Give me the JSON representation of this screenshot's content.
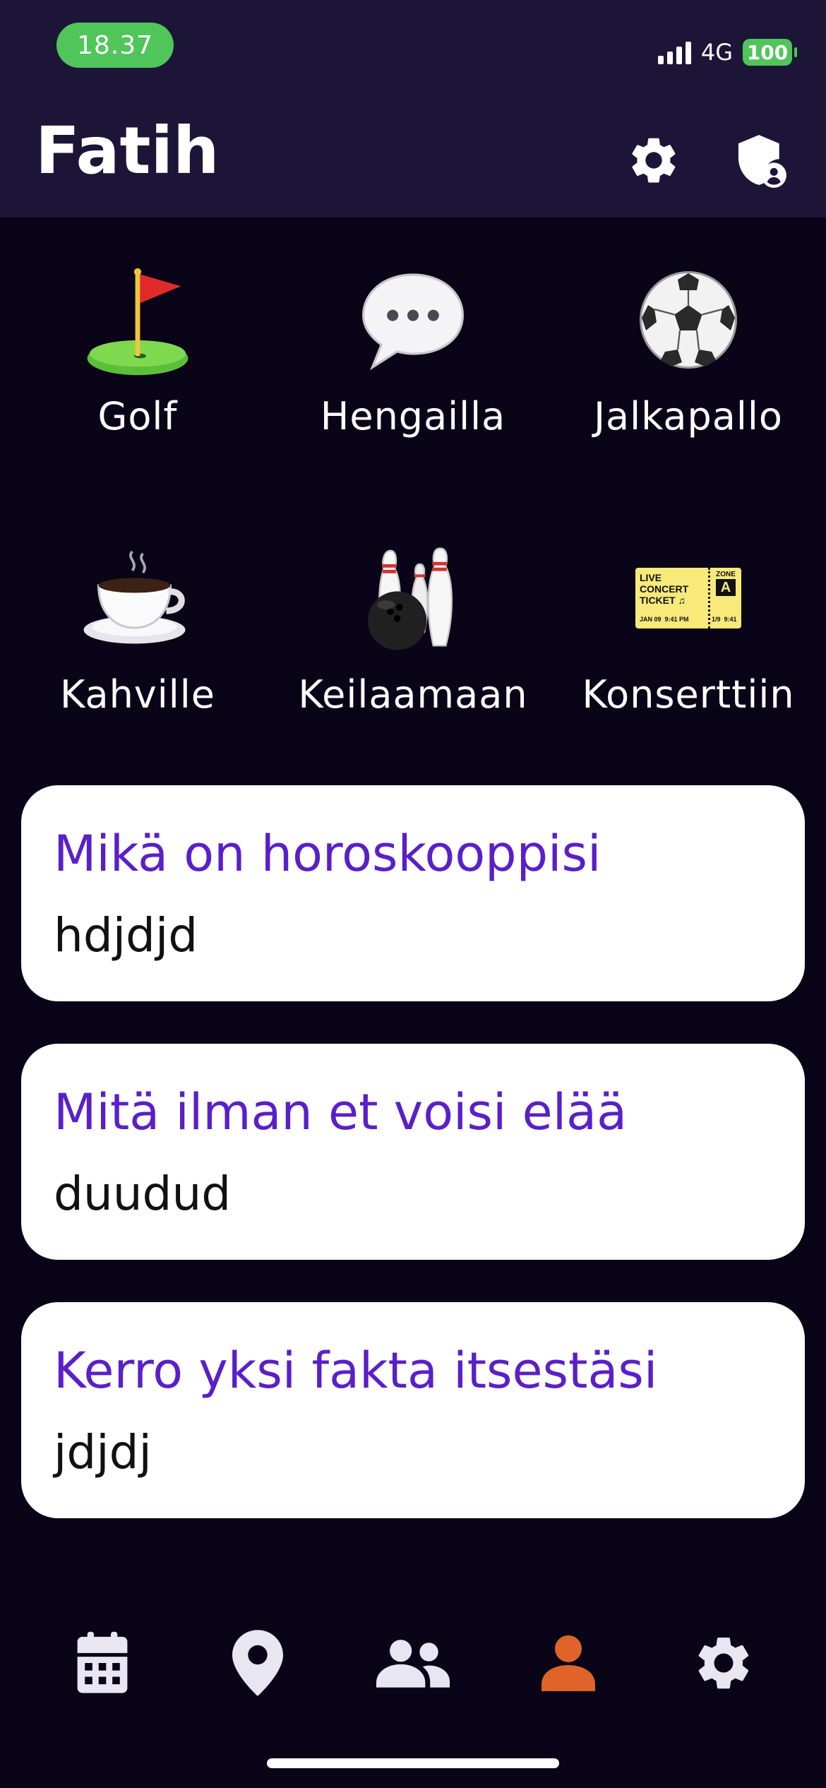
{
  "status_bar": {
    "time": "18.37",
    "network": "4G",
    "battery": "100"
  },
  "header": {
    "title": "Fatih",
    "settings_icon": "gear-icon",
    "privacy_icon": "shield-person-icon"
  },
  "activities": [
    {
      "label": "Golf",
      "icon": "golf-flag-icon"
    },
    {
      "label": "Hengailla",
      "icon": "speech-bubble-icon"
    },
    {
      "label": "Jalkapallo",
      "icon": "soccer-ball-icon"
    },
    {
      "label": "Kahville",
      "icon": "coffee-cup-icon"
    },
    {
      "label": "Keilaamaan",
      "icon": "bowling-icon"
    },
    {
      "label": "Konserttiin",
      "icon": "concert-ticket-icon"
    }
  ],
  "ticket": {
    "line1": "LIVE",
    "line2": "CONCERT",
    "line3": "TICKET ♫",
    "zone": "ZONE",
    "zone_letter": "A",
    "date": "JAN 09",
    "time": "9:41 PM",
    "seat": "1/9",
    "seat_time": "9:41"
  },
  "prompts": [
    {
      "question": "Mikä on horoskooppisi",
      "answer": "hdjdjd"
    },
    {
      "question": "Mitä ilman et voisi elää",
      "answer": "duudud"
    },
    {
      "question": "Kerro yksi fakta itsestäsi",
      "answer": "jdjdj"
    }
  ],
  "tab_bar": {
    "items": [
      {
        "icon": "calendar-icon"
      },
      {
        "icon": "location-pin-icon"
      },
      {
        "icon": "people-icon"
      },
      {
        "icon": "person-icon",
        "active": true
      },
      {
        "icon": "gear-icon"
      }
    ],
    "active_color": "#e0632a",
    "inactive_color": "#e8e6f0"
  },
  "colors": {
    "header_bg": "#1d1538",
    "page_bg": "#0a0418",
    "prompt_question": "#5a1fc9",
    "status_green": "#4fc55a"
  }
}
